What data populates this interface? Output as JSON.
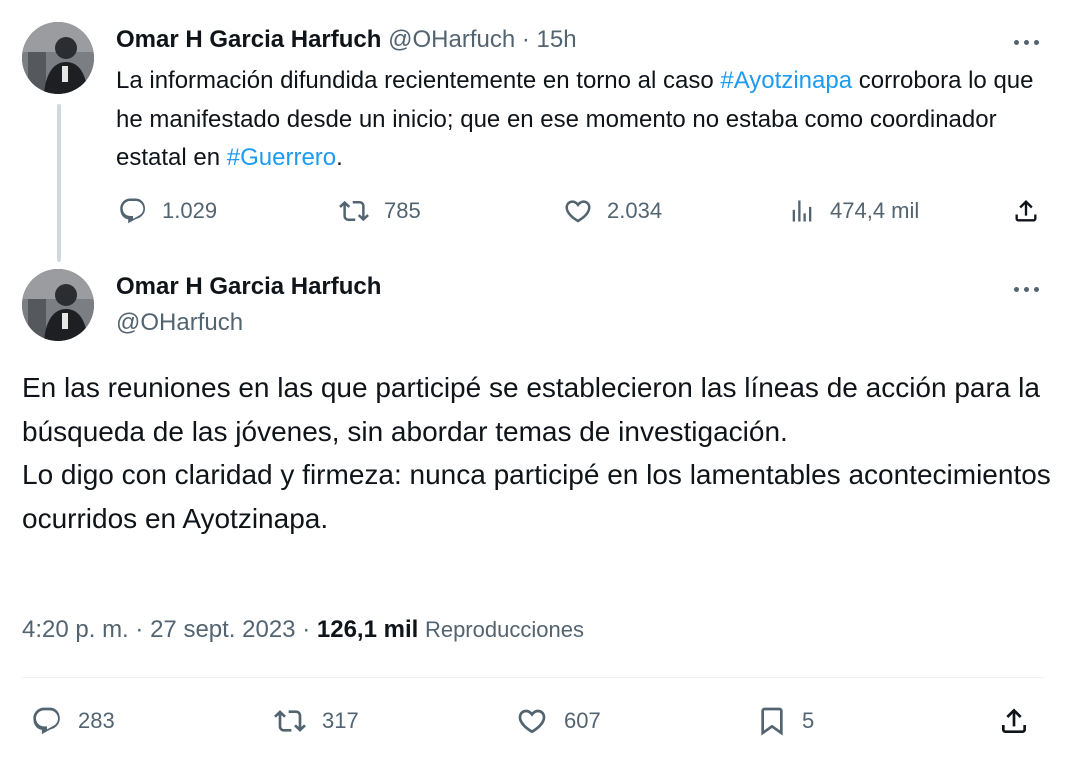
{
  "tweet1": {
    "author_name": "Omar H Garcia Harfuch",
    "author_handle": "@OHarfuch",
    "separator": "·",
    "time_ago": "15h",
    "text_segments": [
      {
        "text": "La información difundida recientemente en torno al caso ",
        "hashtag": false
      },
      {
        "text": "#Ayotzinapa",
        "hashtag": true
      },
      {
        "text": " corrobora lo que he manifestado desde un inicio; que en ese momento no estaba como coordinador estatal en ",
        "hashtag": false
      },
      {
        "text": "#Guerrero",
        "hashtag": true
      },
      {
        "text": ".",
        "hashtag": false
      }
    ],
    "replies": "1.029",
    "reposts": "785",
    "likes": "2.034",
    "views": "474,4 mil"
  },
  "tweet2": {
    "author_name": "Omar H Garcia Harfuch",
    "author_handle": "@OHarfuch",
    "paragraphs": [
      "En las reuniones en las que participé se establecieron las líneas de acción para la búsqueda de las jóvenes, sin abordar temas de investigación.",
      "Lo digo con claridad y firmeza: nunca participé en los lamentables acontecimientos ocurridos en Ayotzinapa."
    ],
    "meta": {
      "time": "4:20 p. m.",
      "sep1": "·",
      "date": "27 sept. 2023",
      "sep2": "·",
      "views_count": "126,1 mil",
      "views_label": "Reproducciones"
    },
    "replies": "283",
    "reposts": "317",
    "likes": "607",
    "bookmarks": "5"
  },
  "colors": {
    "text": "#0f1419",
    "muted": "#536471",
    "hashtag": "#1d9bf0",
    "thread_line": "#cfd9de",
    "divider": "#eff3f4"
  },
  "icons": [
    "avatar",
    "more-icon",
    "reply-icon",
    "repost-icon",
    "like-icon",
    "views-icon",
    "share-icon",
    "bookmark-icon"
  ]
}
